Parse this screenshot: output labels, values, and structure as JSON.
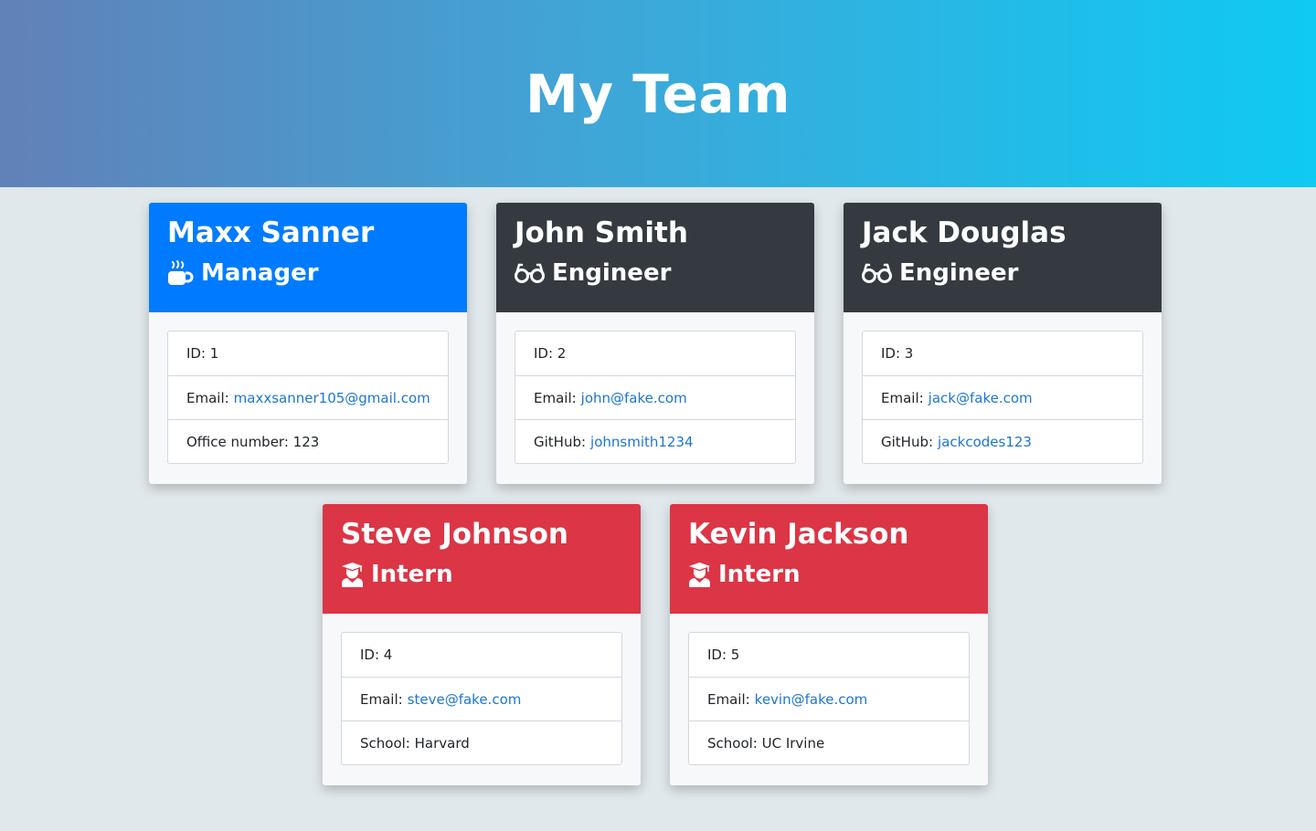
{
  "header": {
    "title": "My Team"
  },
  "cards": [
    {
      "name": "Maxx Sanner",
      "role": "Manager",
      "role_icon": "coffee-icon",
      "color": "#007bff",
      "id_text": "ID: 1",
      "email_label": "Email:",
      "email": "maxxsanner105@gmail.com",
      "extra_label": "Office number: 123",
      "extra_link": ""
    },
    {
      "name": "John Smith",
      "role": "Engineer",
      "role_icon": "glasses-icon",
      "color": "#343a40",
      "id_text": "ID: 2",
      "email_label": "Email:",
      "email": "john@fake.com",
      "extra_label": "GitHub:",
      "extra_link": "johnsmith1234"
    },
    {
      "name": "Jack Douglas",
      "role": "Engineer",
      "role_icon": "glasses-icon",
      "color": "#343a40",
      "id_text": "ID: 3",
      "email_label": "Email:",
      "email": "jack@fake.com",
      "extra_label": "GitHub:",
      "extra_link": "jackcodes123"
    },
    {
      "name": "Steve Johnson",
      "role": "Intern",
      "role_icon": "graduate-icon",
      "color": "#dc3545",
      "id_text": "ID: 4",
      "email_label": "Email:",
      "email": "steve@fake.com",
      "extra_label": "School: Harvard",
      "extra_link": ""
    },
    {
      "name": "Kevin Jackson",
      "role": "Intern",
      "role_icon": "graduate-icon",
      "color": "#dc3545",
      "id_text": "ID: 5",
      "email_label": "Email:",
      "email": "kevin@fake.com",
      "extra_label": "School: UC Irvine",
      "extra_link": ""
    }
  ]
}
